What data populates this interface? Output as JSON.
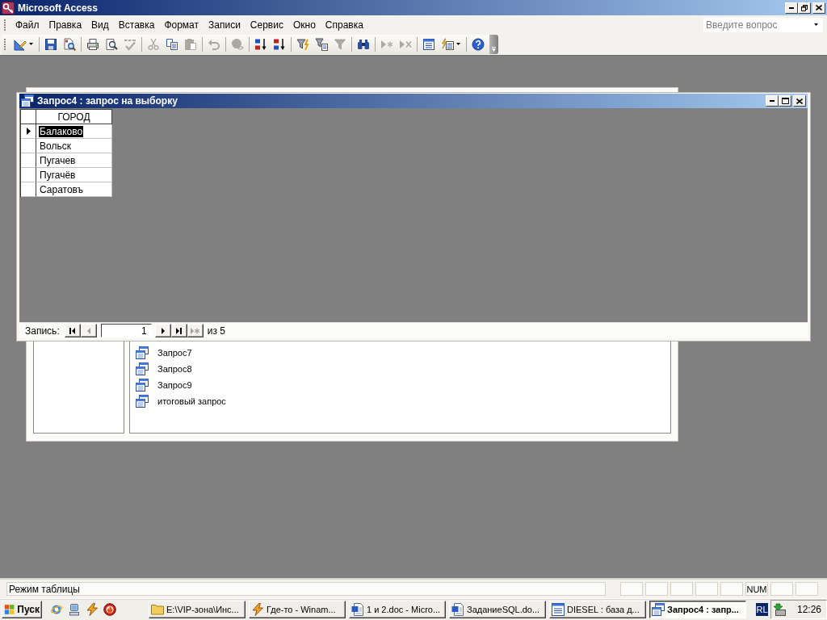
{
  "app_window": {
    "title": "Microsoft Access"
  },
  "menu_bar": {
    "items": [
      "Файл",
      "Правка",
      "Вид",
      "Вставка",
      "Формат",
      "Записи",
      "Сервис",
      "Окно",
      "Справка"
    ]
  },
  "help_box": {
    "placeholder": "Введите вопрос"
  },
  "toolbar": {
    "groups": [
      [
        {
          "kind": "view",
          "disabled": false
        }
      ],
      [
        {
          "kind": "save",
          "disabled": false
        },
        {
          "kind": "file_search",
          "disabled": false
        }
      ],
      [
        {
          "kind": "print",
          "disabled": false
        },
        {
          "kind": "print_preview",
          "disabled": false
        },
        {
          "kind": "spelling",
          "disabled": true
        }
      ],
      [
        {
          "kind": "cut",
          "disabled": true
        },
        {
          "kind": "copy",
          "disabled": false
        },
        {
          "kind": "paste",
          "disabled": true
        }
      ],
      [
        {
          "kind": "undo",
          "disabled": true
        }
      ],
      [
        {
          "kind": "hyperlink",
          "disabled": true
        }
      ],
      [
        {
          "kind": "sort_ascending",
          "disabled": false
        },
        {
          "kind": "sort_descending",
          "disabled": false
        }
      ],
      [
        {
          "kind": "filter_by_selection",
          "disabled": false
        },
        {
          "kind": "filter_by_form",
          "disabled": false
        },
        {
          "kind": "apply_filter",
          "disabled": true
        }
      ],
      [
        {
          "kind": "find",
          "disabled": false
        }
      ],
      [
        {
          "kind": "new_record",
          "disabled": true
        },
        {
          "kind": "delete_record",
          "disabled": true
        }
      ],
      [
        {
          "kind": "database_window",
          "disabled": false
        },
        {
          "kind": "new_object",
          "disabled": false
        }
      ],
      [
        {
          "kind": "help",
          "disabled": false
        }
      ]
    ]
  },
  "query_window": {
    "title": "Запрос4 : запрос на выборку",
    "columns": [
      "ГОРОД"
    ],
    "rows": [
      {
        "cells": [
          "Балаково"
        ],
        "current": true,
        "selected": true
      },
      {
        "cells": [
          "Вольск"
        ],
        "current": false,
        "selected": false
      },
      {
        "cells": [
          "Пугачев"
        ],
        "current": false,
        "selected": false
      },
      {
        "cells": [
          "Пугачёв"
        ],
        "current": false,
        "selected": false
      },
      {
        "cells": [
          "Саратовъ"
        ],
        "current": false,
        "selected": false
      }
    ],
    "navigator": {
      "label": "Запись:",
      "controls": [
        {
          "kind": "first",
          "disabled": false
        },
        {
          "kind": "previous",
          "disabled": true
        },
        {
          "kind": "record_field",
          "value": "1"
        },
        {
          "kind": "next",
          "disabled": false
        },
        {
          "kind": "last",
          "disabled": false
        },
        {
          "kind": "new",
          "disabled": true
        }
      ],
      "count": "из 5"
    }
  },
  "database_window": {
    "objects": [
      "Запрос7",
      "Запрос8",
      "Запрос9",
      "итоговый запрос"
    ]
  },
  "status_bar": {
    "text": "Режим таблицы",
    "num_indicator": "NUM"
  },
  "taskbar": {
    "start_label": "Пуск",
    "quick_launch": [
      {
        "kind": "browser"
      },
      {
        "kind": "computer"
      },
      {
        "kind": "winamp"
      },
      {
        "kind": "burner"
      }
    ],
    "tasks": [
      {
        "kind": "folder",
        "label": "E:\\VIP-зона\\Инс...",
        "selected": false
      },
      {
        "kind": "winamp",
        "label": "Где-то - Winam...",
        "selected": false
      },
      {
        "kind": "word",
        "label": "1 и 2.doc - Micro...",
        "selected": false
      },
      {
        "kind": "word",
        "label": "ЗаданиеSQL.do...",
        "selected": false
      },
      {
        "kind": "database",
        "label": "DIESEL : база д...",
        "selected": false
      },
      {
        "kind": "query",
        "label": "Запрос4 : запр...",
        "selected": true
      }
    ],
    "language": "RL",
    "clock": "12:26"
  }
}
